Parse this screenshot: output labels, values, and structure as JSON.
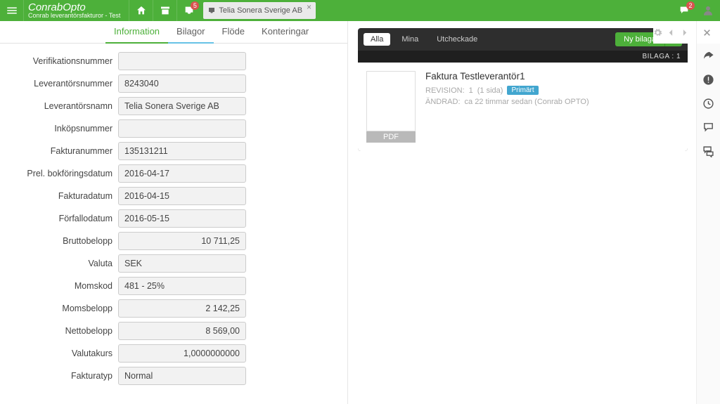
{
  "app": {
    "title": "ConrabOpto",
    "subtitle": "Conrab leverantörsfakturor - Test"
  },
  "topbar": {
    "inbox_badge": "5",
    "chat_badge": "2",
    "document_tab": "Telia Sonera Sverige AB"
  },
  "tabs": {
    "information": "Information",
    "bilagor": "Bilagor",
    "flode": "Flöde",
    "konteringar": "Konteringar"
  },
  "form": {
    "verifikationsnummer": {
      "label": "Verifikationsnummer",
      "value": ""
    },
    "leverantorsnummer": {
      "label": "Leverantörsnummer",
      "value": "8243040"
    },
    "leverantorsnamn": {
      "label": "Leverantörsnamn",
      "value": "Telia Sonera Sverige AB"
    },
    "inkopsnummer": {
      "label": "Inköpsnummer",
      "value": ""
    },
    "fakturanummer": {
      "label": "Fakturanummer",
      "value": "135131211"
    },
    "prel_bokforingsdatum": {
      "label": "Prel. bokföringsdatum",
      "value": "2016-04-17"
    },
    "fakturadatum": {
      "label": "Fakturadatum",
      "value": "2016-04-15"
    },
    "forfallodatum": {
      "label": "Förfallodatum",
      "value": "2016-05-15"
    },
    "bruttobelopp": {
      "label": "Bruttobelopp",
      "value": "10 711,25"
    },
    "valuta": {
      "label": "Valuta",
      "value": "SEK"
    },
    "momskod": {
      "label": "Momskod",
      "value": "481 - 25%"
    },
    "momsbelopp": {
      "label": "Momsbelopp",
      "value": "2 142,25"
    },
    "nettobelopp": {
      "label": "Nettobelopp",
      "value": "8 569,00"
    },
    "valutakurs": {
      "label": "Valutakurs",
      "value": "1,0000000000"
    },
    "fakturatyp": {
      "label": "Fakturatyp",
      "value": "Normal"
    }
  },
  "attachments": {
    "filter_all": "Alla",
    "filter_mine": "Mina",
    "filter_checked": "Utcheckade",
    "new_btn": "Ny bilaga",
    "count_label": "BILAGA :",
    "count_value": "1",
    "item": {
      "title": "Faktura Testleverantör1",
      "revision_label": "REVISION:",
      "revision_value": "1",
      "pages": "(1 sida)",
      "primary_tag": "Primärt",
      "changed_label": "ÄNDRAD:",
      "changed_value": "ca 22 timmar sedan (Conrab OPTO)",
      "thumb_type": "PDF"
    }
  }
}
